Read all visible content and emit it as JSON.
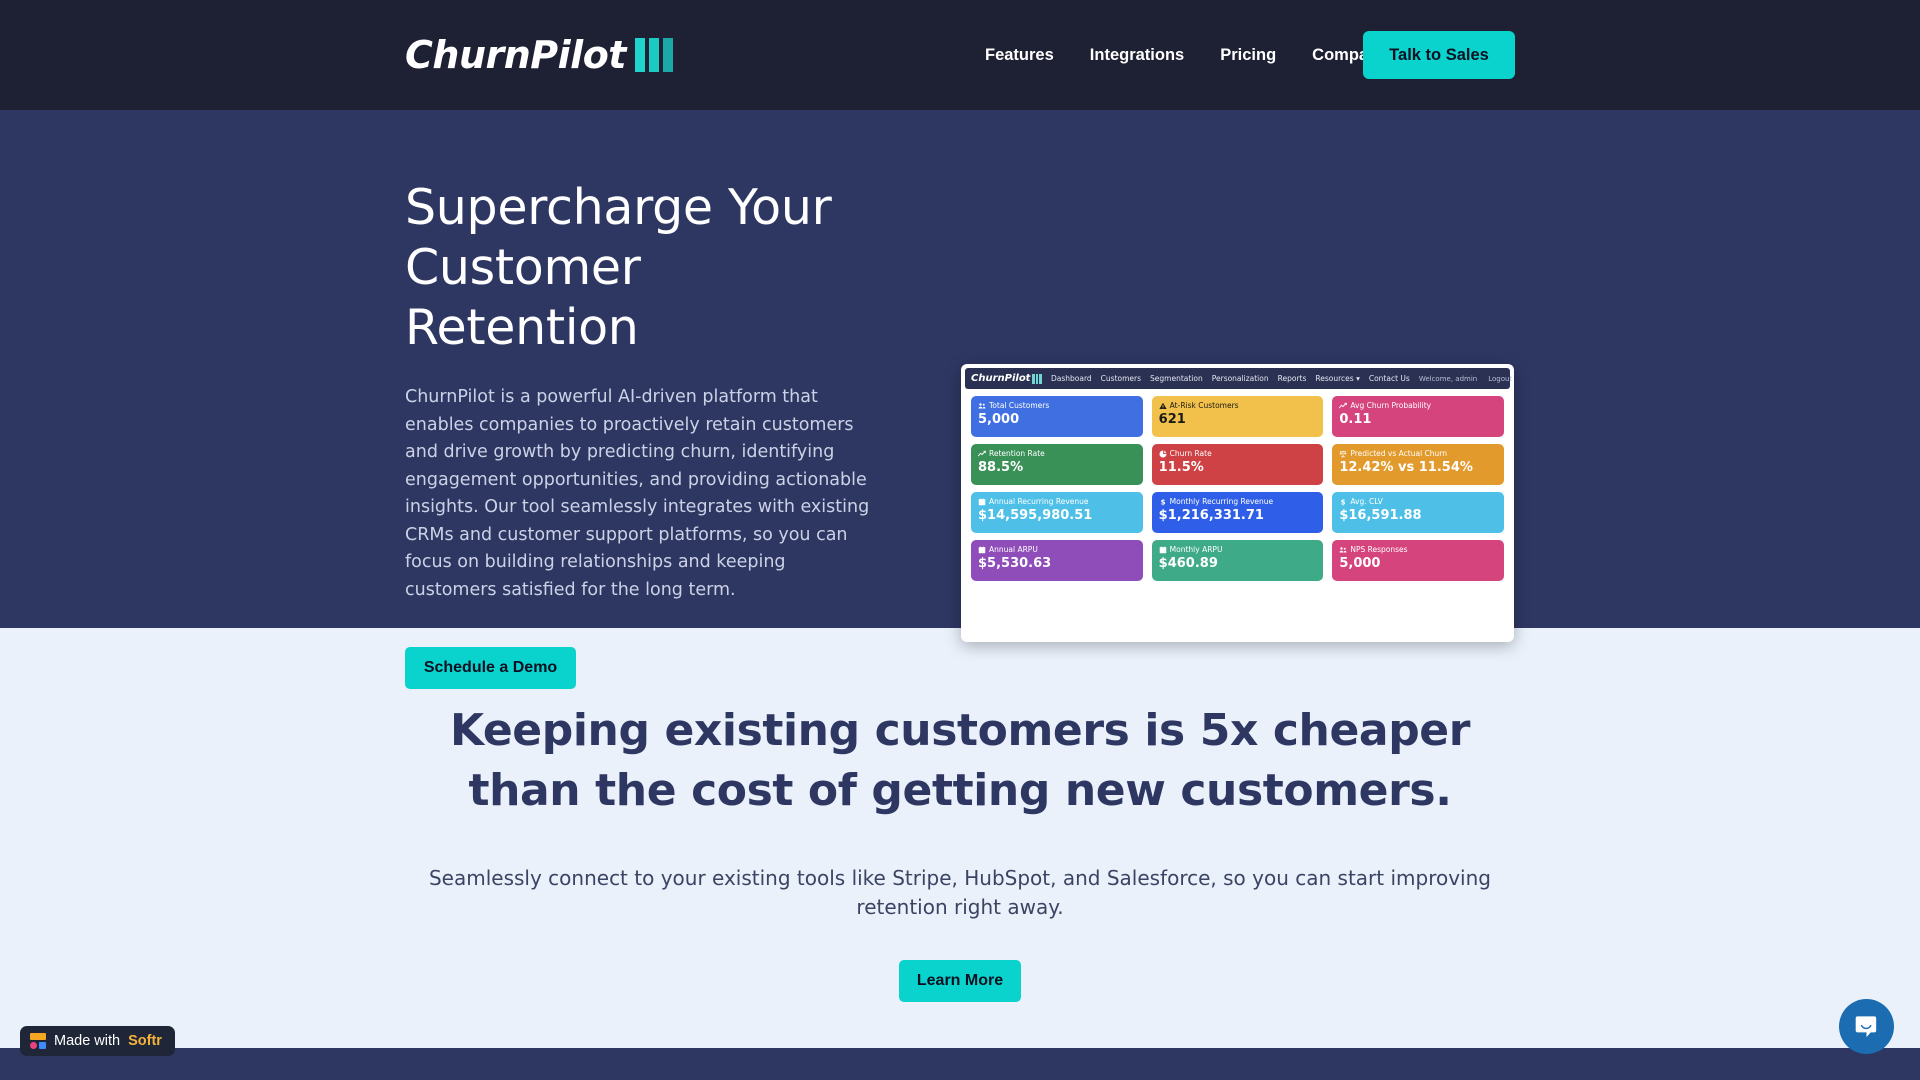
{
  "brand": {
    "name": "ChurnPilot",
    "accent": "#0ad2cd",
    "hero_bg": "#2e3762",
    "topbar_bg": "#1e2033",
    "section_bg": "#eaf1fb"
  },
  "nav": {
    "links": [
      {
        "label": "Features"
      },
      {
        "label": "Integrations"
      },
      {
        "label": "Pricing"
      },
      {
        "label": "Company"
      }
    ],
    "cta": "Talk to Sales"
  },
  "hero": {
    "heading_line1": "Supercharge Your",
    "heading_line2": "Customer Retention",
    "paragraph": "ChurnPilot is a powerful AI-driven platform that enables companies to proactively retain customers and drive growth by predicting churn, identifying engagement opportunities, and providing actionable insights. Our tool seamlessly integrates with existing CRMs and customer support platforms, so you can focus on building relationships and keeping customers satisfied for the long term.",
    "cta": "Schedule a Demo"
  },
  "dashboard_mock": {
    "logo": "ChurnPilot",
    "nav_items": [
      "Dashboard",
      "Customers",
      "Segmentation",
      "Personalization",
      "Reports",
      "Resources ▾",
      "Contact Us"
    ],
    "welcome": "Welcome, admin",
    "logout": "Logout",
    "kpi_rows": [
      [
        {
          "label": "Total Customers",
          "value": "5,000",
          "bg": "#3f6fe0",
          "fg": "#ffffff",
          "icon": "users-icon"
        },
        {
          "label": "At-Risk Customers",
          "value": "621",
          "bg": "#f2c14b",
          "fg": "#1a1a1a",
          "icon": "warning-icon"
        },
        {
          "label": "Avg Churn Probability",
          "value": "0.11",
          "bg": "#d6447e",
          "fg": "#ffffff",
          "icon": "chart-line-icon"
        }
      ],
      [
        {
          "label": "Retention Rate",
          "value": "88.5%",
          "bg": "#3a9158",
          "fg": "#ffffff",
          "icon": "chart-line-icon"
        },
        {
          "label": "Churn Rate",
          "value": "11.5%",
          "bg": "#ce4145",
          "fg": "#ffffff",
          "icon": "pie-chart-icon"
        },
        {
          "label": "Predicted vs Actual Churn",
          "value": "12.42% vs 11.54%",
          "bg": "#e39a2c",
          "fg": "#ffffff",
          "icon": "scales-icon"
        }
      ],
      [
        {
          "label": "Annual Recurring Revenue",
          "value": "$14,595,980.51",
          "bg": "#4ec0e8",
          "fg": "#ffffff",
          "icon": "calendar-icon"
        },
        {
          "label": "Monthly Recurring Revenue",
          "value": "$1,216,331.71",
          "bg": "#2f5fe8",
          "fg": "#ffffff",
          "icon": "dollar-icon"
        },
        {
          "label": "Avg. CLV",
          "value": "$16,591.88",
          "bg": "#4ec0e8",
          "fg": "#ffffff",
          "icon": "dollar-icon"
        }
      ],
      [
        {
          "label": "Annual ARPU",
          "value": "$5,530.63",
          "bg": "#8e4db8",
          "fg": "#ffffff",
          "icon": "calendar-icon"
        },
        {
          "label": "Monthly ARPU",
          "value": "$460.89",
          "bg": "#3faa87",
          "fg": "#ffffff",
          "icon": "calendar-icon"
        },
        {
          "label": "NPS Responses",
          "value": "5,000",
          "bg": "#d6447e",
          "fg": "#ffffff",
          "icon": "users-icon"
        }
      ]
    ]
  },
  "value_section": {
    "heading_line1": "Keeping existing customers is 5x cheaper than",
    "heading_line2": "the cost of getting new customers.",
    "paragraph": "Seamlessly connect to your existing tools like Stripe, HubSpot, and Salesforce, so you can start improving retention right away.",
    "cta": "Learn More"
  },
  "softr_badge": {
    "prefix": "Made with",
    "brand": "Softr"
  },
  "chat_widget": {
    "icon": "chat-bubble-icon"
  }
}
